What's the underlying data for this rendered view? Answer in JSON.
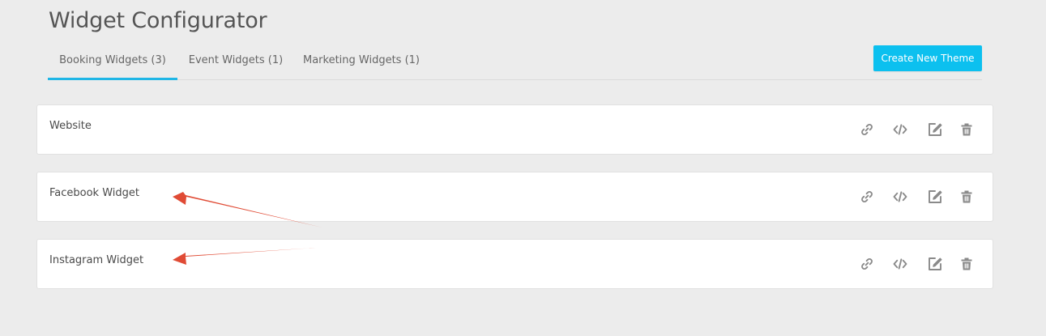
{
  "header": {
    "title": "Widget Configurator"
  },
  "tabs": [
    {
      "label": "Booking Widgets (3)",
      "active": true
    },
    {
      "label": "Event Widgets (1)",
      "active": false
    },
    {
      "label": "Marketing Widgets (1)",
      "active": false
    }
  ],
  "toolbar": {
    "create_label": "Create New Theme"
  },
  "widgets": [
    {
      "name": "Website"
    },
    {
      "name": "Facebook Widget"
    },
    {
      "name": "Instagram Widget"
    }
  ],
  "row_actions": [
    {
      "icon": "link-icon"
    },
    {
      "icon": "code-icon"
    },
    {
      "icon": "edit-icon"
    },
    {
      "icon": "trash-icon"
    }
  ],
  "annotations": {
    "arrow_color": "#e04b35",
    "arrow_targets": [
      "Facebook Widget",
      "Instagram Widget"
    ]
  },
  "colors": {
    "accent": "#1fb6e6",
    "button": "#0cc0ef",
    "background": "#ececec",
    "icon": "#8a8a8a"
  }
}
